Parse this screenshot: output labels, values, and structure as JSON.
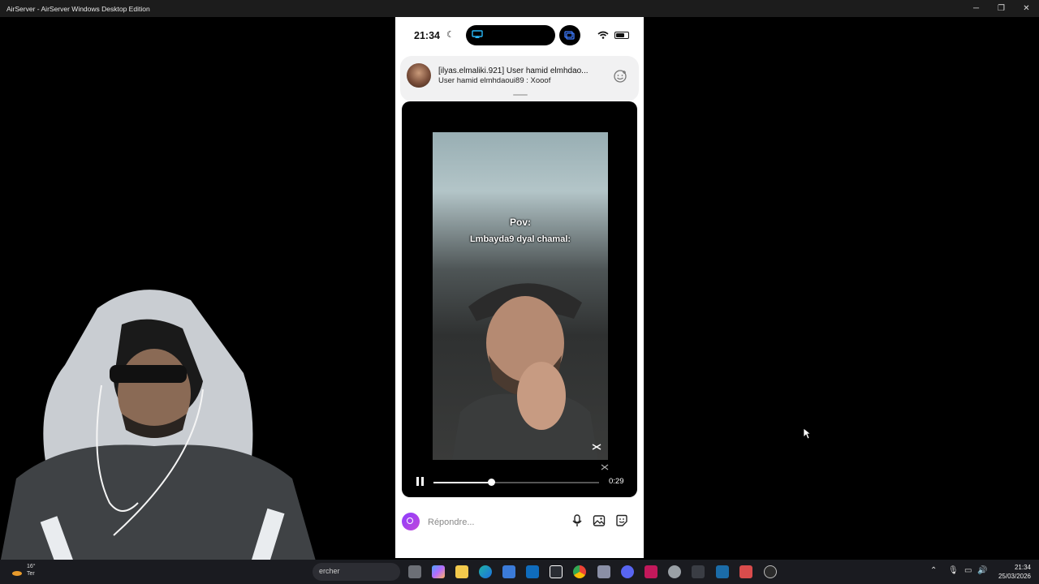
{
  "window": {
    "title": "AirServer - AirServer Windows Desktop Edition",
    "minimize_glyph": "─",
    "restore_glyph": "❐",
    "close_glyph": "✕"
  },
  "phone": {
    "status_bar": {
      "time": "21:34",
      "moon_glyph": "☾"
    },
    "notification": {
      "title": "[ilyas.elmaliki.921] User hamid elmhdao...",
      "message": "User hamid elmhdaoui89 : Xooof"
    },
    "video": {
      "caption_line1": "Pov:",
      "caption_line2": "Lmbayda9 dyal chamal:",
      "duration": "0:29",
      "progress": 0.35
    },
    "reply": {
      "placeholder": "Répondre..."
    }
  },
  "taskbar": {
    "weather_temp": "16°",
    "weather_label": "Ter",
    "search_text": "ercher",
    "clock_time": "21:34",
    "clock_date": "25/03/2026",
    "icons": [
      "task-view-icon",
      "copilot-icon",
      "file-explorer-icon",
      "edge-icon",
      "store-icon",
      "outlook-icon",
      "snipping-icon",
      "chrome-icon",
      "game-icon",
      "discord-icon",
      "app-a-icon",
      "app-x-icon",
      "steam-link-icon",
      "steam-icon",
      "weather-app-icon",
      "obs-icon"
    ]
  },
  "colors": {
    "title_bar": "#1c1c1c",
    "taskbar": "#1a1b20",
    "reply_accent": "#8c3dff"
  }
}
